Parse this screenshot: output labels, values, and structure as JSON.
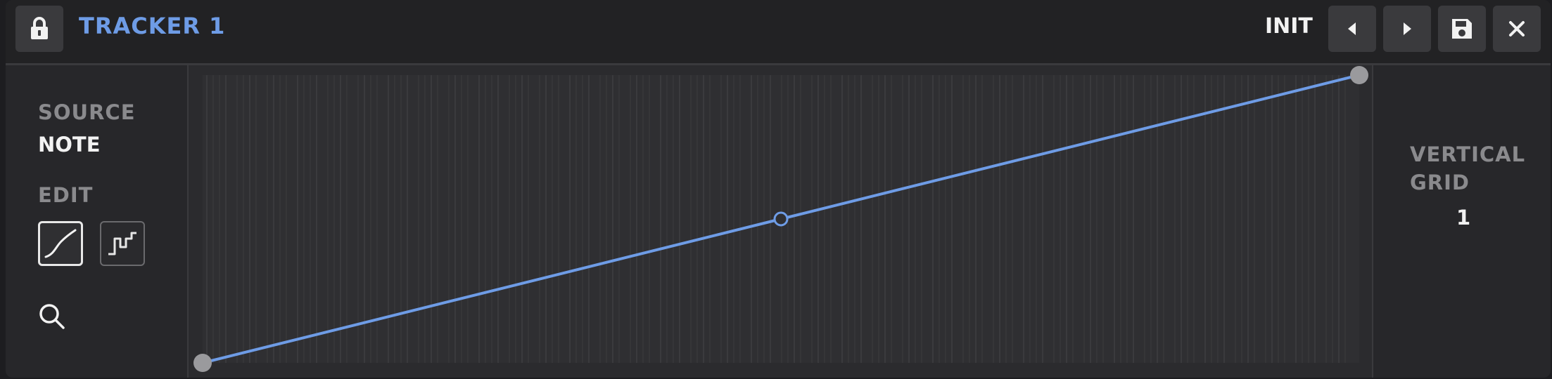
{
  "header": {
    "title": "TRACKER 1",
    "preset_name": "INIT",
    "buttons": {
      "lock": "lock-icon",
      "prev": "chevron-left-icon",
      "next": "chevron-right-icon",
      "save": "save-icon",
      "close": "close-icon"
    }
  },
  "sidebar": {
    "source_label": "SOURCE",
    "source_value": "NOTE",
    "edit_label": "EDIT",
    "edit_modes": [
      {
        "name": "smooth",
        "icon": "smooth-curve-icon",
        "active": true
      },
      {
        "name": "step",
        "icon": "step-curve-icon",
        "active": false
      }
    ],
    "search_icon": "search-icon"
  },
  "graph": {
    "points": [
      {
        "x": 0.0,
        "y": 0.0,
        "type": "end"
      },
      {
        "x": 0.5,
        "y": 0.5,
        "type": "mid"
      },
      {
        "x": 1.0,
        "y": 1.0,
        "type": "end"
      }
    ],
    "colors": {
      "line": "#6e9ce6",
      "endpoint": "#9a9a9d",
      "grid_line": "#3a3a3d",
      "background": "#2b2b2e"
    }
  },
  "right_panel": {
    "grid_label_line1": "VERTICAL",
    "grid_label_line2": "GRID",
    "grid_value": "1"
  }
}
